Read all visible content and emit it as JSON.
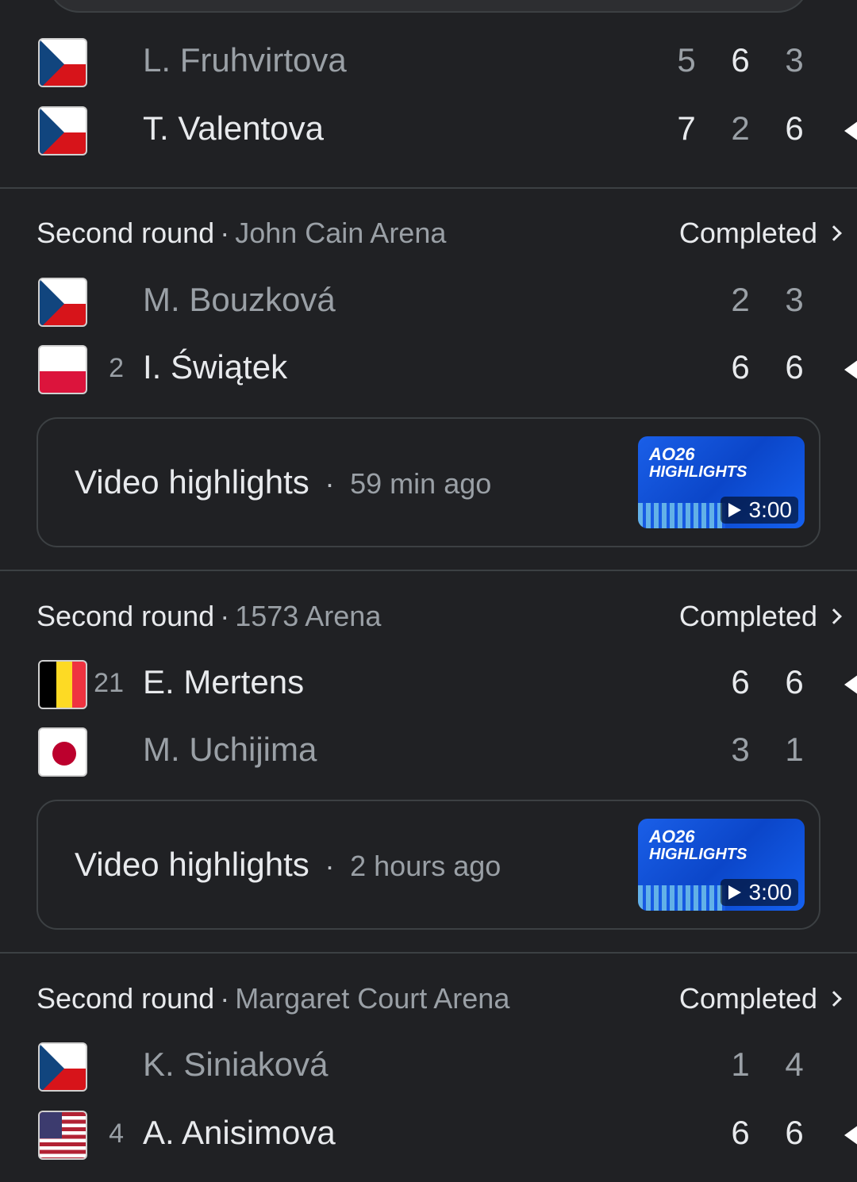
{
  "matches": [
    {
      "players": [
        {
          "flag": "CZE",
          "seed": "",
          "name": "L. Fruhvirtova",
          "scores": [
            "5",
            "6",
            "3"
          ],
          "winner": false
        },
        {
          "flag": "CZE",
          "seed": "",
          "name": "T. Valentova",
          "scores": [
            "7",
            "2",
            "6"
          ],
          "winner": true
        }
      ]
    },
    {
      "round": "Second round",
      "separator": "·",
      "venue": "John Cain Arena",
      "status": "Completed",
      "players": [
        {
          "flag": "CZE",
          "seed": "",
          "name": "M. Bouzková",
          "scores": [
            "2",
            "3"
          ],
          "winner": false
        },
        {
          "flag": "POL",
          "seed": "2",
          "name": "I. Świątek",
          "scores": [
            "6",
            "6"
          ],
          "winner": true
        }
      ],
      "video": {
        "label": "Video highlights",
        "separator": "·",
        "time": "59 min ago",
        "thumb_line1": "AO26",
        "thumb_line2": "HIGHLIGHTS",
        "duration": "3:00"
      }
    },
    {
      "round": "Second round",
      "separator": "·",
      "venue": "1573 Arena",
      "status": "Completed",
      "players": [
        {
          "flag": "BEL",
          "seed": "21",
          "name": "E. Mertens",
          "scores": [
            "6",
            "6"
          ],
          "winner": true
        },
        {
          "flag": "JPN",
          "seed": "",
          "name": "M. Uchijima",
          "scores": [
            "3",
            "1"
          ],
          "winner": false
        }
      ],
      "video": {
        "label": "Video highlights",
        "separator": "·",
        "time": "2 hours ago",
        "thumb_line1": "AO26",
        "thumb_line2": "HIGHLIGHTS",
        "duration": "3:00"
      }
    },
    {
      "round": "Second round",
      "separator": "·",
      "venue": "Margaret Court Arena",
      "status": "Completed",
      "players": [
        {
          "flag": "CZE",
          "seed": "",
          "name": "K. Siniaková",
          "scores": [
            "1",
            "4"
          ],
          "winner": false
        },
        {
          "flag": "USA",
          "seed": "4",
          "name": "A. Anisimova",
          "scores": [
            "6",
            "6"
          ],
          "winner": true
        }
      ]
    }
  ],
  "colors": {
    "background": "#202124",
    "text": "#e8eaed",
    "muted": "#9aa0a6",
    "border": "#3c4043"
  },
  "icons": {
    "winner": "winner-triangle-icon",
    "chevron": "chevron-right-icon",
    "play": "play-icon"
  }
}
